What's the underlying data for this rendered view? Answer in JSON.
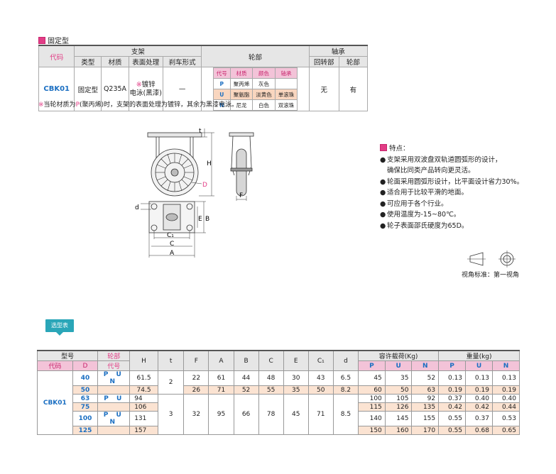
{
  "section": {
    "title": "固定型"
  },
  "spec_table": {
    "header": {
      "code": "代码",
      "bracket": "支架",
      "wheel": "轮部",
      "bearing": "轴承",
      "type": "类型",
      "material": "材质",
      "surface": "表面处理",
      "brake": "刹车形式",
      "swivel": "回转部",
      "wheel_part": "轮部"
    },
    "row": {
      "code": "CBK01",
      "type": "固定型",
      "material": "Q235A",
      "surface_mark": "※",
      "surface_line1": "镀锌",
      "surface_line2": "电泳(黑漆)",
      "brake": "—",
      "swivel": "无",
      "wheel_part": "有"
    },
    "wheel_table": {
      "headers": [
        "代号",
        "材质",
        "颜色",
        "轴承"
      ],
      "rows": [
        [
          "P",
          "聚丙烯",
          "灰色",
          ""
        ],
        [
          "U",
          "聚氨脂",
          "淡黄色",
          "单滚珠"
        ],
        [
          "N",
          "尼龙",
          "白色",
          "双滚珠"
        ]
      ]
    }
  },
  "note": {
    "mark": "※",
    "prefix": "当轮材质为",
    "highlight": "P",
    "suffix": "(聚丙烯)时，支架的表面处理为镀锌，其余为黑漆电泳。"
  },
  "drawing_labels": {
    "t": "t",
    "H": "H",
    "D": "D",
    "F": "F",
    "d": "d",
    "E": "E",
    "B": "B",
    "C1": "C₁",
    "C": "C",
    "A": "A"
  },
  "features": {
    "title": "特点：",
    "items": [
      "支架采用双波盘双轨道圆弧形的设计，",
      "确保比同类产品转向更灵活。",
      "轮面采用圆弧形设计，比平面设计省力30%。",
      "适合用于比较平滑的地面。",
      "可应用于各个行业。",
      "使用温度为-15~80℃。",
      "轮子表面邵氏硬度为65D。"
    ],
    "projection_label": "视角标准：第一视角"
  },
  "selection_tag": "选型表",
  "main_table": {
    "header": {
      "model": "型号",
      "code": "代码",
      "D": "D",
      "wheel": "轮部",
      "wheel_code": "代号",
      "H": "H",
      "t": "t",
      "F": "F",
      "A": "A",
      "B": "B",
      "C": "C",
      "E": "E",
      "C1": "C₁",
      "d": "d",
      "load": "容许载荷(Kg)",
      "weight": "重量(kg)",
      "P": "P",
      "U": "U",
      "N": "N"
    },
    "code": "CBK01",
    "rows": [
      {
        "D": "40",
        "wheel": "P U N",
        "H": "61.5",
        "load": [
          "45",
          "35",
          "52"
        ],
        "weight": [
          "0.13",
          "0.13",
          "0.13"
        ]
      },
      {
        "D": "50",
        "wheel": "",
        "H": "74.5",
        "load": [
          "60",
          "50",
          "63"
        ],
        "weight": [
          "0.19",
          "0.19",
          "0.19"
        ]
      },
      {
        "D": "63",
        "wheel": "P U",
        "H": "94",
        "load": [
          "100",
          "105",
          "92"
        ],
        "weight": [
          "0.37",
          "0.40",
          "0.40"
        ]
      },
      {
        "D": "75",
        "wheel": "",
        "H": "106",
        "load": [
          "115",
          "126",
          "135"
        ],
        "weight": [
          "0.42",
          "0.42",
          "0.44"
        ]
      },
      {
        "D": "100",
        "wheel": "P U N",
        "H": "131",
        "load": [
          "140",
          "145",
          "155"
        ],
        "weight": [
          "0.55",
          "0.37",
          "0.53"
        ]
      },
      {
        "D": "125",
        "wheel": "",
        "H": "157",
        "load": [
          "150",
          "160",
          "170"
        ],
        "weight": [
          "0.55",
          "0.68",
          "0.65"
        ]
      }
    ],
    "group1": {
      "t": "2",
      "F": "22",
      "A": "61",
      "B": "44",
      "C": "48",
      "E": "30",
      "C1": "43",
      "d": "6.5"
    },
    "group1b": {
      "F": "26",
      "A": "71",
      "B": "52",
      "C": "55",
      "E": "35",
      "C1": "50",
      "d": "8.2"
    },
    "group2": {
      "t": "3",
      "F": "32",
      "A": "95",
      "B": "66",
      "C": "78",
      "E": "45",
      "C1": "71",
      "d": "8.5"
    }
  }
}
